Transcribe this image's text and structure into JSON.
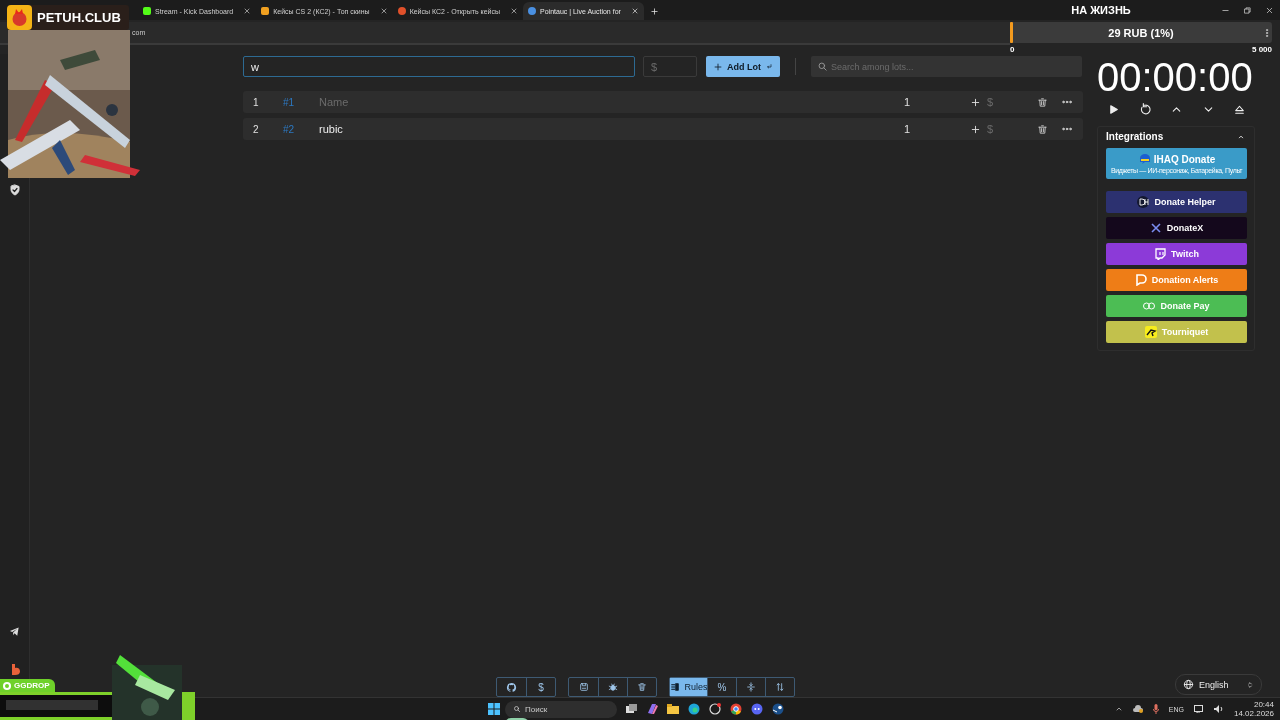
{
  "browser": {
    "tabs": [
      {
        "title": "Stream - Kick Dashboard",
        "selected": false,
        "color": "#53fc18"
      },
      {
        "title": "Кейсы CS 2 (КС2) - Топ скины",
        "selected": false,
        "color": "#f0a020"
      },
      {
        "title": "Кейсы КС2 - Открыть кейсы",
        "selected": false,
        "color": "#e0502a"
      },
      {
        "title": "Pointauc | Live Auction for",
        "selected": true,
        "color": "#4a90e2"
      }
    ],
    "address": "com"
  },
  "overlays": {
    "top_badge": "PETUH.CLUB",
    "bottom_badge": "GGDROP"
  },
  "goal": {
    "title": "НА ЖИЗНЬ",
    "reading": "29 RUB (1%)",
    "level": 0.01,
    "min": "0",
    "max": "5 000"
  },
  "lot_form": {
    "name_value": "w",
    "amount_placeholder": "$",
    "add_button": "Add Lot",
    "search_placeholder": "Search among lots..."
  },
  "lots": [
    {
      "index": "1",
      "number": "#1",
      "placeholder": "Name",
      "amount": "1",
      "bid_placeholder": "$"
    },
    {
      "index": "2",
      "number": "#2",
      "name": "rubic",
      "amount": "1",
      "bid_placeholder": "$"
    }
  ],
  "timer": {
    "time": "00:00:00"
  },
  "integrations": {
    "title": "Integrations",
    "expanded": true,
    "items": [
      {
        "label": "IHAQ Donate",
        "subtitle": "Виджеты — ИИ-персонаж, Батарейка, Пульт",
        "color": "#3a9bc8"
      },
      {
        "label": "Donate Helper",
        "color": "#2c3170"
      },
      {
        "label": "DonateX",
        "color": "#14081c"
      },
      {
        "label": "Twitch",
        "color": "#8c3ad8"
      },
      {
        "label": "Donation Alerts",
        "color": "#ee7d17"
      },
      {
        "label": "Donate Pay",
        "color": "#4cbd54"
      },
      {
        "label": "Tourniquet",
        "color": "#c2c14c"
      }
    ]
  },
  "toolbar": {
    "dollar": "$",
    "rules": {
      "label": "Rules",
      "selected": true
    },
    "percent": {
      "label": "%",
      "selected": false
    }
  },
  "language": "English",
  "taskbar": {
    "search_placeholder": "Поиск",
    "lang": "ENG",
    "time": "20:44",
    "date": "14.02.2026"
  }
}
